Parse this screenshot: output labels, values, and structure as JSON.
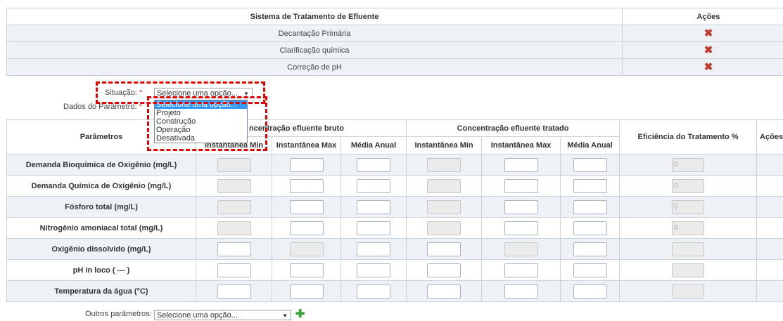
{
  "systems_table": {
    "header_system": "Sistema de Tratamento de Efluente",
    "header_actions": "Ações",
    "rows": [
      {
        "name": "Decantação Primária",
        "action_icon": "delete-x-icon"
      },
      {
        "name": "Clarificação química",
        "action_icon": "delete-x-icon"
      },
      {
        "name": "Correção de pH",
        "action_icon": "delete-x-icon"
      }
    ],
    "delete_glyph": "✖"
  },
  "form": {
    "situacao_label": "Situação:",
    "dados_label": "Dados do Parâmetro:",
    "required_mark": "*",
    "situacao_value": "Selecione uma opção...",
    "dropdown_arrow": "▼",
    "dropdown_options": [
      "Selecione uma opção...",
      "Projeto",
      "Construção",
      "Operação",
      "Desativada"
    ]
  },
  "params_table": {
    "col_parametros": "Parâmetros",
    "group_bruto": "Concentração efluente bruto",
    "group_bruto_visible": "ncentração efluente bruto",
    "group_tratado": "Concentração efluente tratado",
    "col_eficiencia": "Eficiência do Tratamento %",
    "col_acoes": "Ações",
    "sub_inst_min": "Instantânea Min",
    "sub_inst_max": "Instantânea Max",
    "sub_media": "Média Anual",
    "rows": [
      {
        "name": "Demanda Bioquímica de Oxigênio (mg/L)",
        "eficiencia": "0"
      },
      {
        "name": "Demanda Química de Oxigênio (mg/L)",
        "eficiencia": "0"
      },
      {
        "name": "Fósforo total (mg/L)",
        "eficiencia": "0"
      },
      {
        "name": "Nitrogênio amoniacal total (mg/L)",
        "eficiencia": "0"
      },
      {
        "name": "Oxigênio dissolvido (mg/L)",
        "eficiencia": ""
      },
      {
        "name": "pH in loco ( --- )",
        "eficiencia": ""
      },
      {
        "name": "Temperatura da água (°C)",
        "eficiencia": ""
      }
    ]
  },
  "outros": {
    "label": "Outros parâmetros:",
    "value": "Selecione uma opção...",
    "add_glyph": "✚"
  },
  "colors": {
    "highlight": "#e00000",
    "delete": "#c0392b",
    "add": "#3aa63a",
    "row_alt": "#eef2f7",
    "selected_option": "#3399ff"
  }
}
